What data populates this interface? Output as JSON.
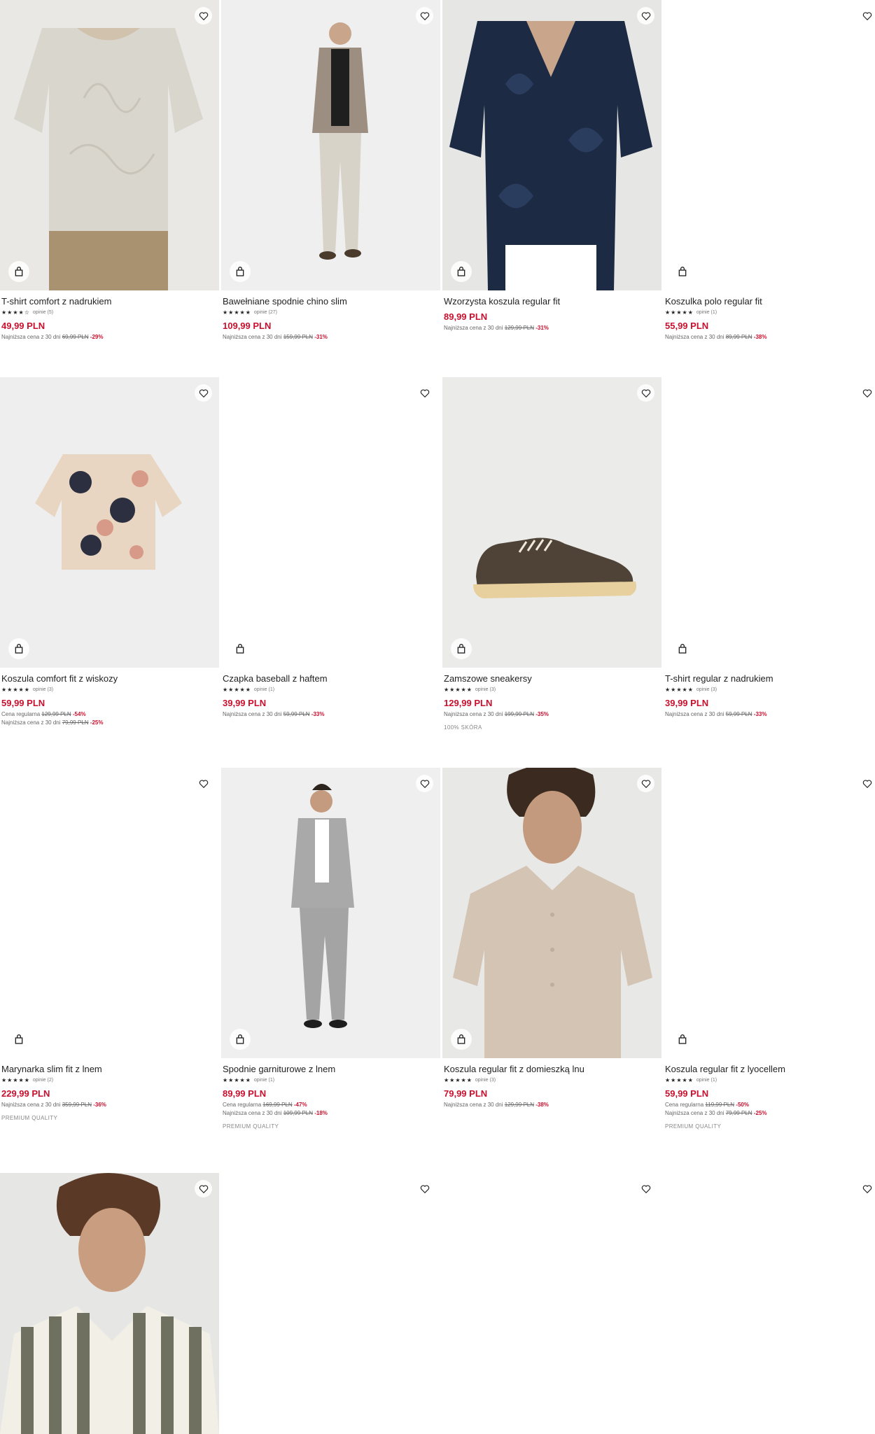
{
  "icons": {
    "wishlist": "heart-outline-icon",
    "add_to_bag": "shopping-bag-icon"
  },
  "colors": {
    "price": "#c8102e",
    "discount": "#c8102e"
  },
  "products": [
    {
      "name": "T-shirt comfort z nadrukiem",
      "stars": "★★★★☆",
      "reviews": "opinie (5)",
      "price": "49,99 PLN",
      "lines": [
        {
          "label": "Najniższa cena z 30 dni",
          "old": "69,99 PLN",
          "disc": "-29%"
        }
      ],
      "tag": ""
    },
    {
      "name": "Bawełniane spodnie chino slim",
      "stars": "★★★★★",
      "reviews": "opinie (27)",
      "price": "109,99 PLN",
      "lines": [
        {
          "label": "Najniższa cena z 30 dni",
          "old": "159,99 PLN",
          "disc": "-31%"
        }
      ],
      "tag": ""
    },
    {
      "name": "Wzorzysta koszula regular fit",
      "stars": "",
      "reviews": "",
      "price": "89,99 PLN",
      "lines": [
        {
          "label": "Najniższa cena z 30 dni",
          "old": "129,99 PLN",
          "disc": "-31%"
        }
      ],
      "tag": ""
    },
    {
      "name": "Koszulka polo regular fit",
      "stars": "★★★★★",
      "reviews": "opinie (1)",
      "price": "55,99 PLN",
      "lines": [
        {
          "label": "Najniższa cena z 30 dni",
          "old": "89,99 PLN",
          "disc": "-38%"
        }
      ],
      "tag": ""
    },
    {
      "name": "Koszula comfort fit z wiskozy",
      "stars": "★★★★★",
      "reviews": "opinie (3)",
      "price": "59,99 PLN",
      "lines": [
        {
          "label": "Cena regularna",
          "old": "129,99 PLN",
          "disc": "-54%"
        },
        {
          "label": "Najniższa cena z 30 dni",
          "old": "79,99 PLN",
          "disc": "-25%"
        }
      ],
      "tag": ""
    },
    {
      "name": "Czapka baseball z haftem",
      "stars": "★★★★★",
      "reviews": "opinie (1)",
      "price": "39,99 PLN",
      "lines": [
        {
          "label": "Najniższa cena z 30 dni",
          "old": "59,99 PLN",
          "disc": "-33%"
        }
      ],
      "tag": ""
    },
    {
      "name": "Zamszowe sneakersy",
      "stars": "★★★★★",
      "reviews": "opinie (3)",
      "price": "129,99 PLN",
      "lines": [
        {
          "label": "Najniższa cena z 30 dni",
          "old": "199,99 PLN",
          "disc": "-35%"
        }
      ],
      "tag": "100% SKÓRA"
    },
    {
      "name": "T-shirt regular z nadrukiem",
      "stars": "★★★★★",
      "reviews": "opinie (3)",
      "price": "39,99 PLN",
      "lines": [
        {
          "label": "Najniższa cena z 30 dni",
          "old": "59,99 PLN",
          "disc": "-33%"
        }
      ],
      "tag": ""
    },
    {
      "name": "Marynarka slim fit z lnem",
      "stars": "★★★★★",
      "reviews": "opinie (2)",
      "price": "229,99 PLN",
      "lines": [
        {
          "label": "Najniższa cena z 30 dni",
          "old": "359,99 PLN",
          "disc": "-36%"
        }
      ],
      "tag": "PREMIUM QUALITY"
    },
    {
      "name": "Spodnie garniturowe z lnem",
      "stars": "★★★★★",
      "reviews": "opinie (1)",
      "price": "89,99 PLN",
      "lines": [
        {
          "label": "Cena regularna",
          "old": "169,99 PLN",
          "disc": "-47%"
        },
        {
          "label": "Najniższa cena z 30 dni",
          "old": "109,99 PLN",
          "disc": "-18%"
        }
      ],
      "tag": "PREMIUM QUALITY"
    },
    {
      "name": "Koszula regular fit z domieszką lnu",
      "stars": "★★★★★",
      "reviews": "opinie (3)",
      "price": "79,99 PLN",
      "lines": [
        {
          "label": "Najniższa cena z 30 dni",
          "old": "129,99 PLN",
          "disc": "-38%"
        }
      ],
      "tag": ""
    },
    {
      "name": "Koszula regular fit z lyocellem",
      "stars": "★★★★★",
      "reviews": "opinie (1)",
      "price": "59,99 PLN",
      "lines": [
        {
          "label": "Cena regularna",
          "old": "119,99 PLN",
          "disc": "-50%"
        },
        {
          "label": "Najniższa cena z 30 dni",
          "old": "79,99 PLN",
          "disc": "-25%"
        }
      ],
      "tag": "PREMIUM QUALITY"
    }
  ]
}
